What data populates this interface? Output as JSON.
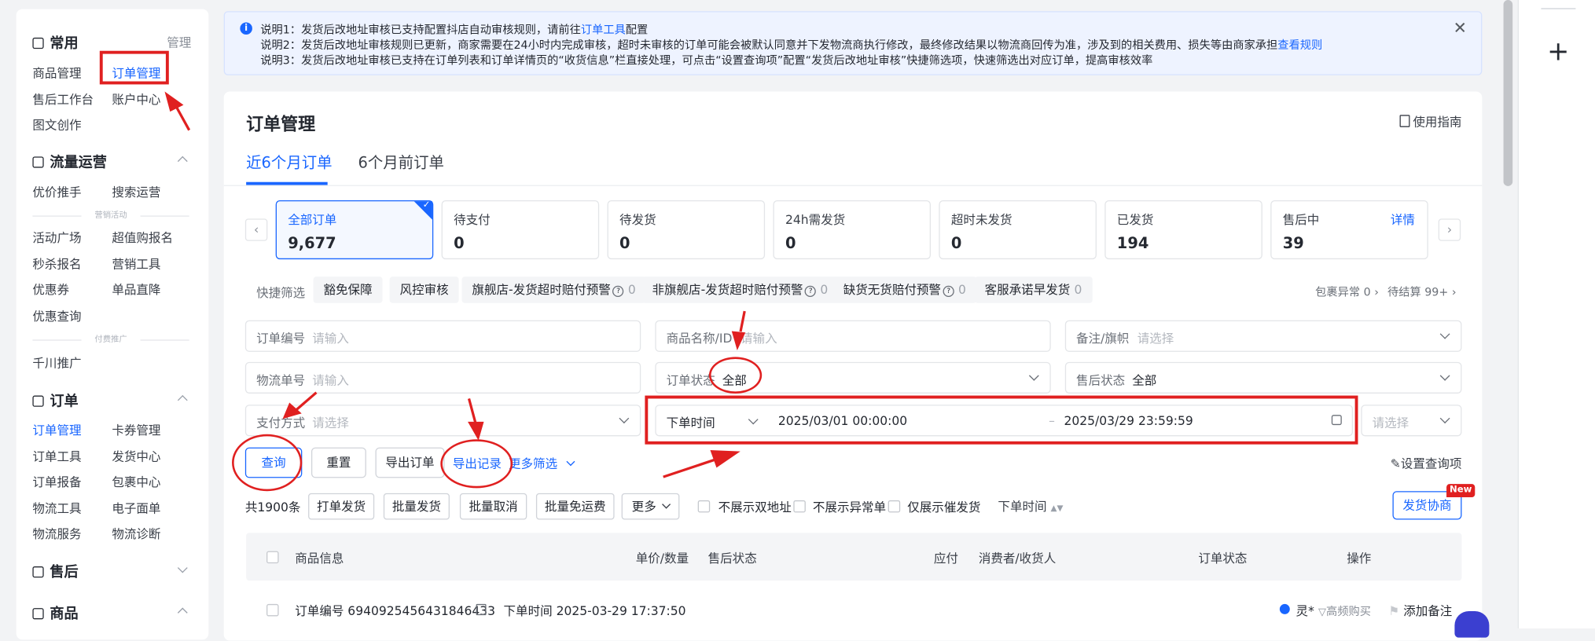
{
  "sidebar": {
    "common": {
      "title": "常用",
      "manage": "管理",
      "items": [
        "商品管理",
        "订单管理",
        "售后工作台",
        "账户中心",
        "图文创作"
      ]
    },
    "traffic": {
      "title": "流量运营",
      "items": [
        "优价推手",
        "搜索运营"
      ],
      "divider": "营销活动",
      "items2": [
        "活动广场",
        "超值购报名",
        "秒杀报名",
        "营销工具",
        "优惠券",
        "单品直降",
        "优惠查询"
      ],
      "divider2": "付费推广",
      "items3": [
        "千川推广"
      ]
    },
    "order": {
      "title": "订单",
      "items": [
        "订单管理",
        "卡券管理",
        "订单工具",
        "发货中心",
        "订单报备",
        "包裹中心",
        "物流工具",
        "电子面单",
        "物流服务",
        "物流诊断"
      ]
    },
    "aftersale": {
      "title": "售后"
    },
    "product": {
      "title": "商品"
    }
  },
  "notice": {
    "line1_prefix": "说明1：发货后改地址审核已支持配置抖店自动审核规则，请前往",
    "line1_link": "订单工具",
    "line1_suffix": "配置",
    "line2_prefix": "说明2：发货后改地址审核规则已更新，商家需要在24小时内完成审核，超时未审核的订单可能会被默认同意并下发物流商执行修改，最终修改结果以物流商回传为准，涉及到的相关费用、损失等由商家承担",
    "line2_link": "查看规则",
    "line3": "说明3：发货后改地址审核已支持在订单列表和订单详情页的“收货信息”栏直接处理，可点击“设置查询项”配置“发货后改地址审核”快捷筛选项，快速筛选出对应订单，提高审核效率"
  },
  "main": {
    "title": "订单管理",
    "guide": "使用指南",
    "tabs": [
      "近6个月订单",
      "6个月前订单"
    ],
    "stats": [
      {
        "label": "全部订单",
        "value": "9,677"
      },
      {
        "label": "待支付",
        "value": "0"
      },
      {
        "label": "待发货",
        "value": "0"
      },
      {
        "label": "24h需发货",
        "value": "0"
      },
      {
        "label": "超时未发货",
        "value": "0"
      },
      {
        "label": "已发货",
        "value": "194"
      },
      {
        "label": "售后中",
        "value": "39",
        "detail": "详情"
      }
    ],
    "quick": {
      "label": "快捷筛选",
      "chips": [
        {
          "text": "豁免保障",
          "count": ""
        },
        {
          "text": "风控审核",
          "count": ""
        },
        {
          "text": "旗舰店-发货超时赔付预警",
          "count": "0"
        },
        {
          "text": "非旗舰店-发货超时赔付预警",
          "count": "0"
        },
        {
          "text": "缺货无货赔付预警",
          "count": "0"
        },
        {
          "text": "客服承诺早发货",
          "count": "0"
        }
      ],
      "pkg_abnormal": "包裹异常 0",
      "pending_settle": "待结算 99+"
    },
    "filters": {
      "order_no": {
        "label": "订单编号",
        "placeholder": "请输入"
      },
      "product": {
        "label": "商品名称/ID",
        "placeholder": "请输入"
      },
      "remark": {
        "label": "备注/旗帜",
        "placeholder": "请选择"
      },
      "logistics_no": {
        "label": "物流单号",
        "placeholder": "请输入"
      },
      "order_status": {
        "label": "订单状态",
        "value": "全部"
      },
      "aftersale_status": {
        "label": "售后状态",
        "value": "全部"
      },
      "pay_method": {
        "label": "支付方式",
        "placeholder": "请选择"
      },
      "time_type": "下单时间",
      "time_start": "2025/03/01 00:00:00",
      "time_sep": "–",
      "time_end": "2025/03/29 23:59:59",
      "extra_placeholder": "请选择"
    },
    "actions": {
      "query": "查询",
      "reset": "重置",
      "export": "导出订单",
      "export_log": "导出记录",
      "more_filter": "更多筛选",
      "setting": "设置查询项"
    },
    "bulk": {
      "total": "共1900条",
      "buttons": [
        "打单发货",
        "批量发货",
        "批量取消",
        "批量免运费",
        "更多"
      ],
      "checks": [
        "不展示双地址",
        "不展示异常单",
        "仅展示催发货"
      ],
      "sort": "下单时间",
      "collab": "发货协商",
      "new_badge": "New"
    },
    "table": {
      "headers": [
        "商品信息",
        "单价/数量",
        "售后状态",
        "应付",
        "消费者/收货人",
        "订单状态",
        "操作"
      ],
      "row": {
        "order_no": "订单编号 6940925456431846433",
        "order_time": "下单时间 2025-03-29 17:37:50",
        "buyer": "灵*",
        "high_freq": "高频购买",
        "add_remark": "添加备注"
      }
    }
  },
  "colors": {
    "accent": "#1966ff",
    "annotation": "#e02020",
    "notice_bg": "#eef3ff"
  }
}
